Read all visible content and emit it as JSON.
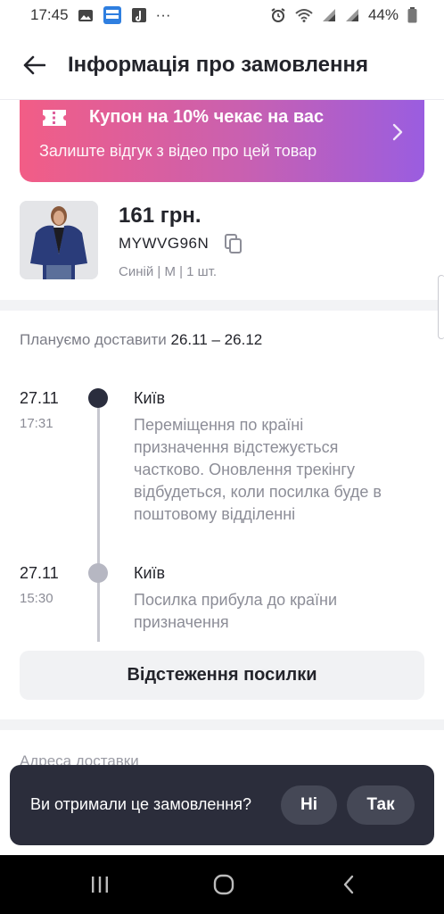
{
  "status_bar": {
    "time": "17:45",
    "dots": "···",
    "battery_percent": "44%",
    "left_icons": [
      "gallery-icon",
      "wordbit-app-icon",
      "music-app-icon"
    ],
    "right_icons": [
      "alarm-icon",
      "wifi-icon",
      "signal-icon",
      "signal-icon",
      "battery-icon"
    ]
  },
  "header": {
    "title": "Інформація про замовлення",
    "back_icon": "arrow-left-icon"
  },
  "coupon": {
    "title": "Купон на 10% чекає на вас",
    "subtitle": "Залиште відгук з відео про цей товар",
    "icon": "ticket-icon",
    "gradient": [
      "#f25d86",
      "#9a5de0"
    ]
  },
  "product": {
    "price": "161 грн.",
    "order_id": "MYWVG96N",
    "variant": "Синій | M | 1 шт."
  },
  "delivery": {
    "label": "Плануємо доставити",
    "dates": "26.11 – 26.12"
  },
  "timeline": [
    {
      "date": "27.11",
      "time": "17:31",
      "city": "Київ",
      "desc": "Переміщення по країні призначення відстежується частково. Оновлення трекінгу відбудеться, коли посилка буде в поштовому відділенні",
      "state": "active"
    },
    {
      "date": "27.11",
      "time": "15:30",
      "city": "Київ",
      "desc": "Посилка прибула до країни призначення",
      "state": "past"
    }
  ],
  "track_button": "Відстеження посилки",
  "address_label": "Адреса доставки",
  "toast": {
    "question": "Ви отримали це замовлення?",
    "no": "Ні",
    "yes": "Так"
  },
  "colors": {
    "accent_dark": "#2b2d3b",
    "timeline_active": "#2a2d3d",
    "timeline_past": "#b6b7c2"
  }
}
